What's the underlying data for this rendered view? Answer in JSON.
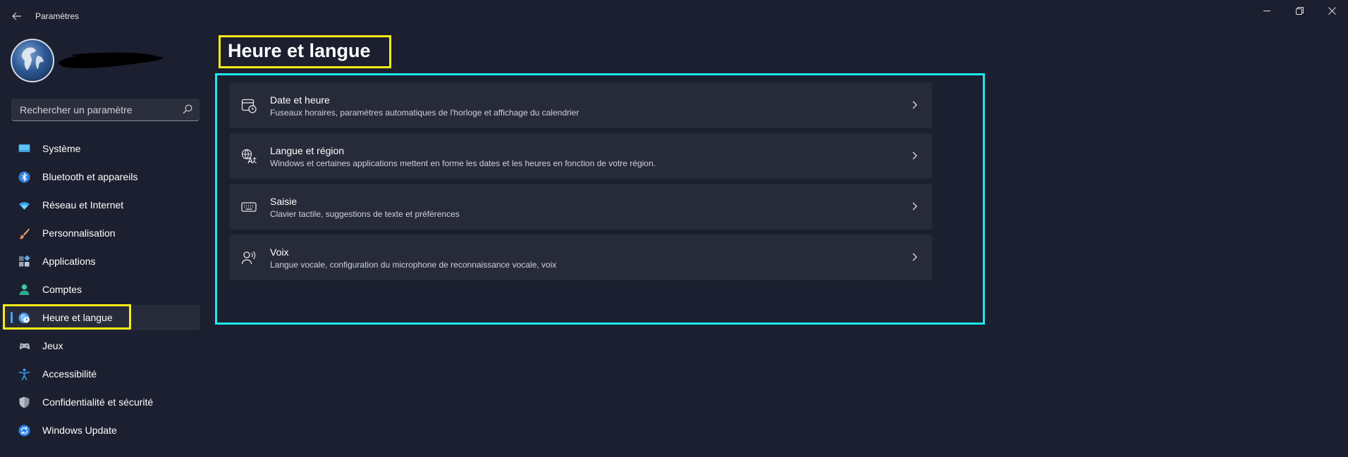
{
  "app": {
    "title": "Paramètres"
  },
  "search": {
    "placeholder": "Rechercher un paramètre"
  },
  "sidebar": {
    "items": [
      {
        "label": "Système",
        "icon": "display-icon"
      },
      {
        "label": "Bluetooth et appareils",
        "icon": "bluetooth-icon"
      },
      {
        "label": "Réseau et Internet",
        "icon": "wifi-icon"
      },
      {
        "label": "Personnalisation",
        "icon": "brush-icon"
      },
      {
        "label": "Applications",
        "icon": "apps-icon"
      },
      {
        "label": "Comptes",
        "icon": "person-icon"
      },
      {
        "label": "Heure et langue",
        "icon": "globe-clock-icon",
        "active": true
      },
      {
        "label": "Jeux",
        "icon": "gamepad-icon"
      },
      {
        "label": "Accessibilité",
        "icon": "accessibility-icon"
      },
      {
        "label": "Confidentialité et sécurité",
        "icon": "shield-icon"
      },
      {
        "label": "Windows Update",
        "icon": "update-icon"
      }
    ]
  },
  "main": {
    "title": "Heure et langue",
    "cards": [
      {
        "title": "Date et heure",
        "desc": "Fuseaux horaires, paramètres automatiques de l'horloge et affichage du calendrier",
        "icon": "calendar-clock-icon"
      },
      {
        "title": "Langue et région",
        "desc": "Windows et certaines applications mettent en forme les dates et les heures en fonction de votre région.",
        "icon": "language-icon"
      },
      {
        "title": "Saisie",
        "desc": "Clavier tactile, suggestions de texte et préférences",
        "icon": "keyboard-icon"
      },
      {
        "title": "Voix",
        "desc": "Langue vocale, configuration du microphone de reconnaissance vocale, voix",
        "icon": "speech-icon"
      }
    ]
  },
  "colors": {
    "background": "#1b1f2f",
    "card": "#262a39",
    "accent": "#4aa3ff",
    "highlight_yellow": "#f6ec17",
    "highlight_cyan": "#1ee8ef"
  }
}
